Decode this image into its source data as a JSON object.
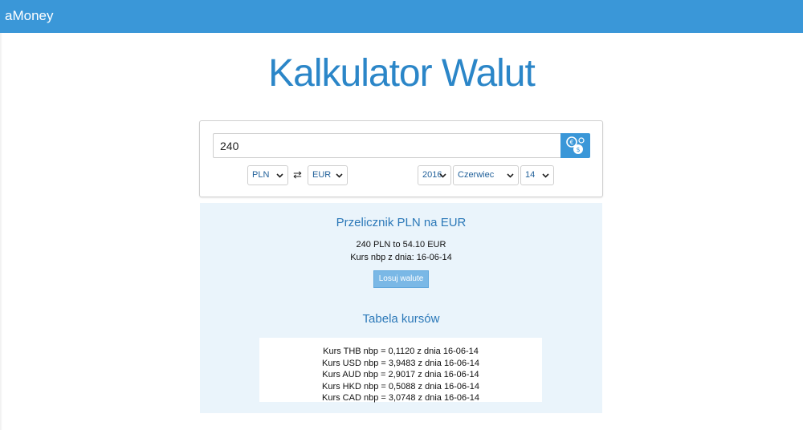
{
  "navbar": {
    "brand": "aMoney"
  },
  "page": {
    "title": "Kalkulator Walut"
  },
  "form": {
    "amount_value": "240",
    "from_currency": "PLN",
    "swap_symbol": "⇄",
    "to_currency": "EUR",
    "year": "2016",
    "month": "Czerwiec",
    "day": "14",
    "convert_icon": "currency-exchange-icon"
  },
  "result": {
    "title": "Przelicznik PLN na EUR",
    "conversion": "240 PLN to 54.10 EUR",
    "rate_date": "Kurs nbp z dnia: 16-06-14",
    "random_button_label": "Losuj walute"
  },
  "rates_table": {
    "title": "Tabela kursów",
    "rows": [
      "Kurs THB nbp = 0,1120 z dnia 16-06-14",
      "Kurs USD nbp = 3,9483 z dnia 16-06-14",
      "Kurs AUD nbp = 2,9017 z dnia 16-06-14",
      "Kurs HKD nbp = 0,5088 z dnia 16-06-14",
      "Kurs CAD nbp = 3,0748 z dnia 16-06-14"
    ]
  },
  "colors": {
    "navbar": "#3a97d8",
    "title": "#2b86c8",
    "result_background": "#eaf4fb",
    "button": "#7ab8e6"
  }
}
